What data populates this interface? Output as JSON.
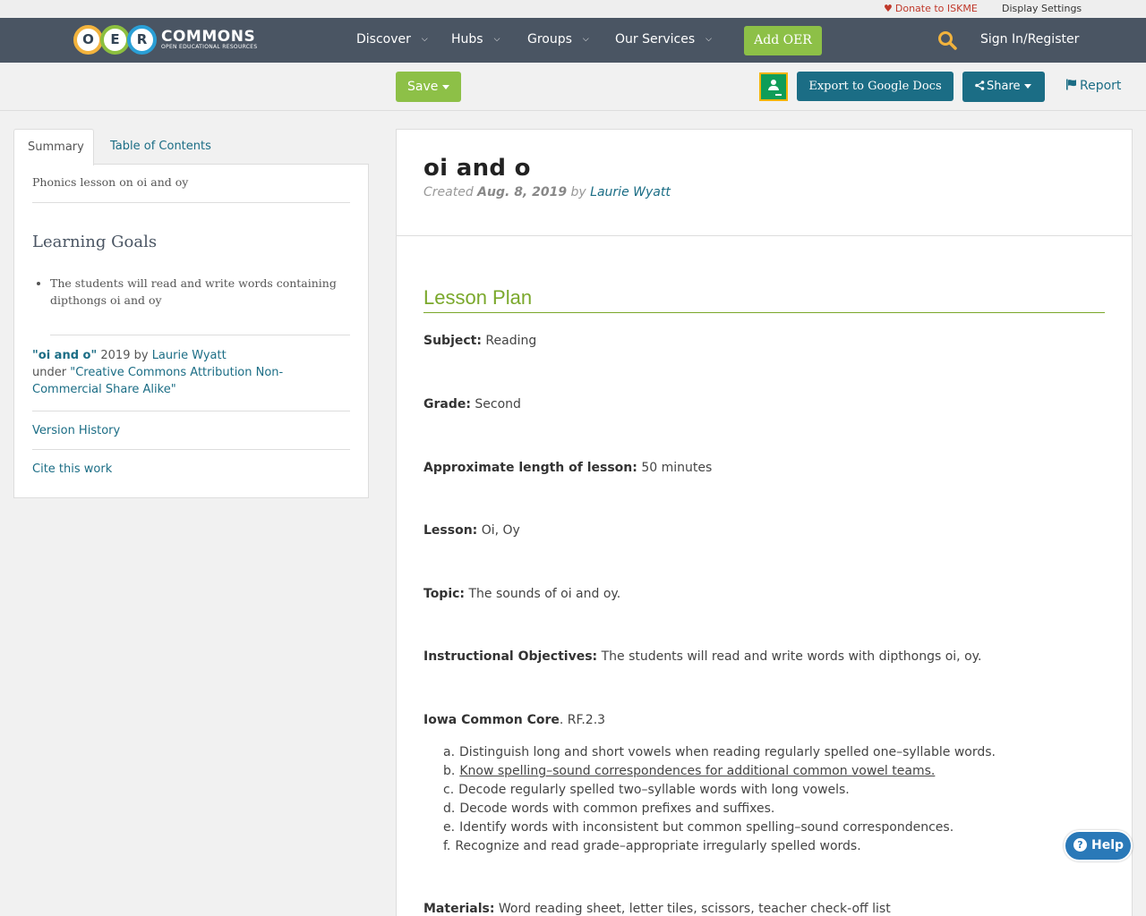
{
  "util": {
    "donate": "Donate to ISKME",
    "display_settings": "Display Settings"
  },
  "nav": {
    "logo_letters": [
      "O",
      "E",
      "R"
    ],
    "logo_word": "COMMONS",
    "logo_tagline": "OPEN EDUCATIONAL RESOURCES",
    "items": [
      "Discover",
      "Hubs",
      "Groups",
      "Our Services"
    ],
    "add_oer": "Add OER",
    "signin": "Sign In/Register"
  },
  "actions": {
    "save": "Save",
    "export": "Export to Google Docs",
    "share": "Share",
    "report": "Report"
  },
  "sidebar": {
    "tabs": [
      "Summary",
      "Table of Contents"
    ],
    "summary_text": "Phonics lesson on oi and oy",
    "goals_title": "Learning Goals",
    "goals": [
      "The students will read and write words containing dipthongs oi and oy"
    ],
    "attribution": {
      "title": "\"oi and o\"",
      "year_by": " 2019 by ",
      "author": "Laurie Wyatt",
      "under": "under ",
      "license": "\"Creative Commons Attribution Non-Commercial Share Alike\""
    },
    "version_history": "Version History",
    "cite": "Cite this work"
  },
  "doc": {
    "title": "oi and o",
    "created_label": "Created ",
    "date": "Aug. 8, 2019",
    "by_label": " by ",
    "author": "Laurie Wyatt",
    "section_title": "Lesson Plan",
    "fields": [
      {
        "label": "Subject:",
        "value": " Reading"
      },
      {
        "label": "Grade:",
        "value": " Second"
      },
      {
        "label": "Approximate length of lesson:",
        "value": " 50 minutes"
      },
      {
        "label": "Lesson:",
        "value": " Oi, Oy"
      },
      {
        "label": "Topic:",
        "value": " The sounds of oi and oy."
      },
      {
        "label": "Instructional Objectives:",
        "value": " The students will read and write words with dipthongs oi, oy."
      },
      {
        "label": "Iowa Common Core",
        "value": ". RF.2.3"
      },
      {
        "label": "Materials:",
        "value": " Word reading sheet, letter tiles, scissors, teacher check-off list"
      }
    ],
    "standards": [
      {
        "marker": "a.",
        "text": "Distinguish long and short vowels when reading regularly spelled one–syllable words."
      },
      {
        "marker": "b.",
        "text": "Know spelling–sound correspondences for additional common vowel teams."
      },
      {
        "marker": "c.",
        "text": "Decode regularly spelled two–syllable words with long vowels."
      },
      {
        "marker": "d.",
        "text": "Decode words with common prefixes and suffixes."
      },
      {
        "marker": "e.",
        "text": "Identify words with inconsistent but common spelling–sound correspondences."
      },
      {
        "marker": "f.",
        "text": "Recognize and read grade–appropriate irregularly spelled words."
      }
    ]
  },
  "help": "Help"
}
